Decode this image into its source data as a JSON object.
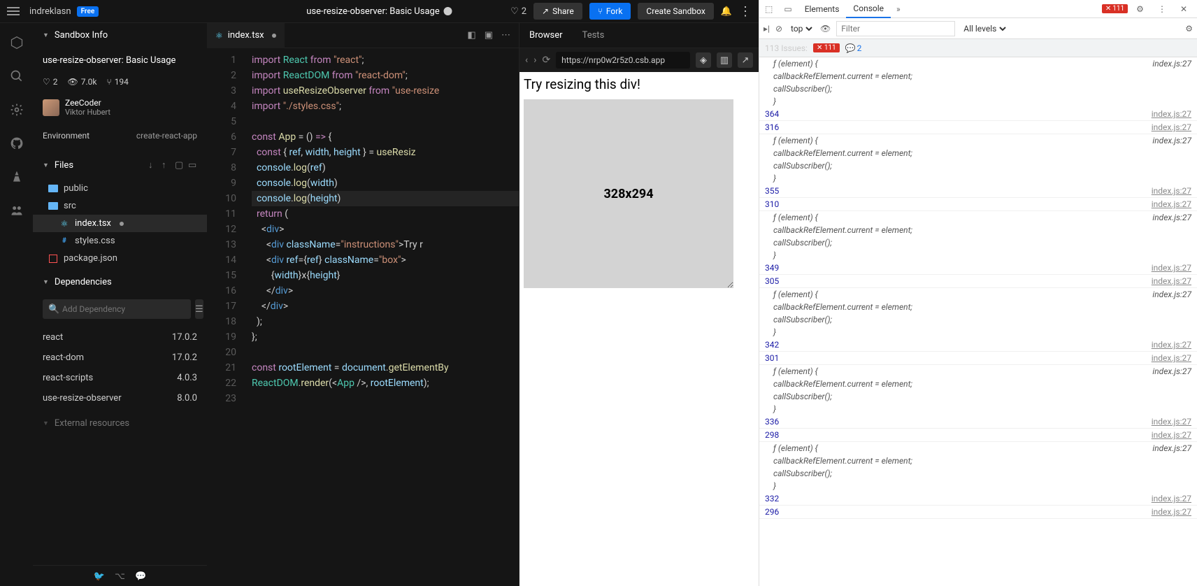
{
  "topbar": {
    "username": "indreklasn",
    "plan": "Free",
    "title": "use-resize-observer: Basic Usage",
    "likes": "2",
    "share": "Share",
    "fork": "Fork",
    "create": "Create Sandbox"
  },
  "sidebar": {
    "info_header": "Sandbox Info",
    "project_title": "use-resize-observer: Basic Usage",
    "stats": {
      "likes": "2",
      "views": "7.0k",
      "forks": "194"
    },
    "author": {
      "name": "ZeeCoder",
      "sub": "Viktor Hubert"
    },
    "env": {
      "label": "Environment",
      "value": "create-react-app"
    },
    "files_header": "Files",
    "files": [
      {
        "name": "public",
        "type": "folder"
      },
      {
        "name": "src",
        "type": "folder"
      },
      {
        "name": "index.tsx",
        "type": "react",
        "nested": true,
        "active": true,
        "modified": true
      },
      {
        "name": "styles.css",
        "type": "css",
        "nested": true
      },
      {
        "name": "package.json",
        "type": "json"
      }
    ],
    "deps_header": "Dependencies",
    "dep_placeholder": "Add Dependency",
    "deps": [
      {
        "name": "react",
        "version": "17.0.2"
      },
      {
        "name": "react-dom",
        "version": "17.0.2"
      },
      {
        "name": "react-scripts",
        "version": "4.0.3"
      },
      {
        "name": "use-resize-observer",
        "version": "8.0.0"
      }
    ],
    "ext_header": "External resources"
  },
  "editor": {
    "tab_name": "index.tsx"
  },
  "preview": {
    "tabs": {
      "browser": "Browser",
      "tests": "Tests"
    },
    "url": "https://nrp0w2r5z0.csb.app",
    "instructions": "Try resizing this div!",
    "box_text": "328x294",
    "trunc": "T"
  },
  "devtools": {
    "tabs": {
      "elements": "Elements",
      "console": "Console"
    },
    "err_count": "111",
    "toolbar": {
      "context": "top",
      "filter_ph": "Filter",
      "levels": "All levels"
    },
    "issues": {
      "label": "113 Issues:",
      "errors": "111",
      "info": "2"
    },
    "source": "index.js:27",
    "func_lines": [
      "ƒ (element) {",
      "    callbackRefElement.current = element;",
      "    callSubscriber();",
      "  }"
    ],
    "logs": [
      {
        "t": "n",
        "v": "364"
      },
      {
        "t": "n",
        "v": "316"
      },
      {
        "t": "f"
      },
      {
        "t": "n",
        "v": "355"
      },
      {
        "t": "n",
        "v": "310"
      },
      {
        "t": "f"
      },
      {
        "t": "n",
        "v": "349"
      },
      {
        "t": "n",
        "v": "305"
      },
      {
        "t": "f"
      },
      {
        "t": "n",
        "v": "342"
      },
      {
        "t": "n",
        "v": "301"
      },
      {
        "t": "f"
      },
      {
        "t": "n",
        "v": "336"
      },
      {
        "t": "n",
        "v": "298"
      },
      {
        "t": "f"
      },
      {
        "t": "n",
        "v": "332"
      },
      {
        "t": "n",
        "v": "296"
      }
    ]
  }
}
